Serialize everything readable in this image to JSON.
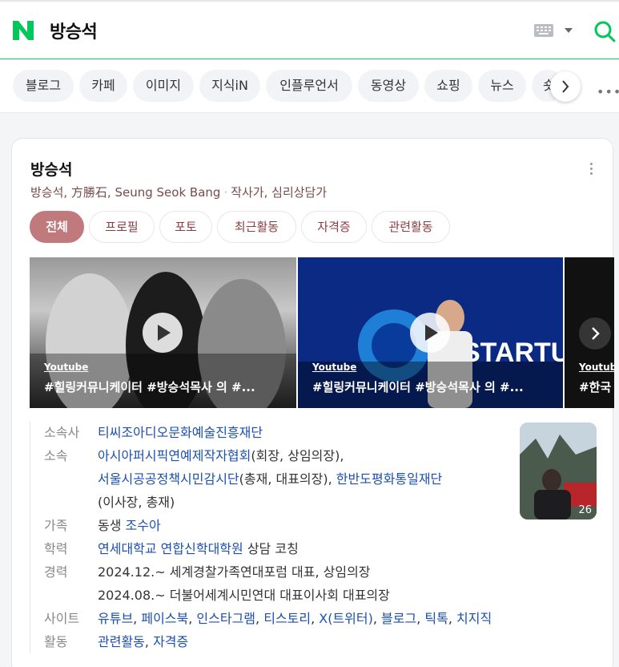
{
  "search": {
    "query": "방승석"
  },
  "tabs": [
    "블로그",
    "카페",
    "이미지",
    "지식iN",
    "인플루언서",
    "동영상",
    "쇼핑",
    "뉴스",
    "숏"
  ],
  "tabs_more": "•••",
  "profile": {
    "name": "방승석",
    "aliases": "방승석, 方勝石, Seung Seok Bang",
    "occupation": "작사가, 심리상담가",
    "chips": [
      "전체",
      "프로필",
      "포토",
      "최근활동",
      "자격증",
      "관련활동"
    ],
    "videos": [
      {
        "source": "Youtube",
        "title": "#힐링커뮤니케이터 #방승석목사 의 #..."
      },
      {
        "source": "Youtube",
        "title": "#힐링커뮤니케이터 #방승석목사 의 #..."
      },
      {
        "source": "Youtube",
        "title": "#한국"
      }
    ],
    "photo_count": "26",
    "info": {
      "affiliation_label": "소속사",
      "affiliation": "티씨조아디오문화예술진흥재단",
      "org_label": "소속",
      "org1": "아시아퍼시픽연예제작자협회",
      "org1_role": "(회장, 상임의장),",
      "org2": "서울시공공정책시민감시단",
      "org2_role": "(총재, 대표의장),",
      "org3": "한반도평화통일재단",
      "org3_role": "(이사장, 총재)",
      "family_label": "가족",
      "family_rel": "동생",
      "family_name": "조수아",
      "edu_label": "학력",
      "edu_school": "연세대학교 연합신학대학원",
      "edu_detail": "상담 코칭",
      "career_label": "경력",
      "career1": "2024.12.~ 세계경찰가족연대포럼 대표, 상임의장",
      "career2": "2024.08.~ 더불어세계시민연대 대표이사회 대표의장",
      "site_label": "사이트",
      "sites": [
        "유튜브",
        "페이스북",
        "인스타그램",
        "티스토리",
        "X(트위터)",
        "블로그",
        "틱톡",
        "치지직"
      ],
      "activity_label": "활동",
      "activities": [
        "관련활동",
        "자격증"
      ]
    }
  }
}
